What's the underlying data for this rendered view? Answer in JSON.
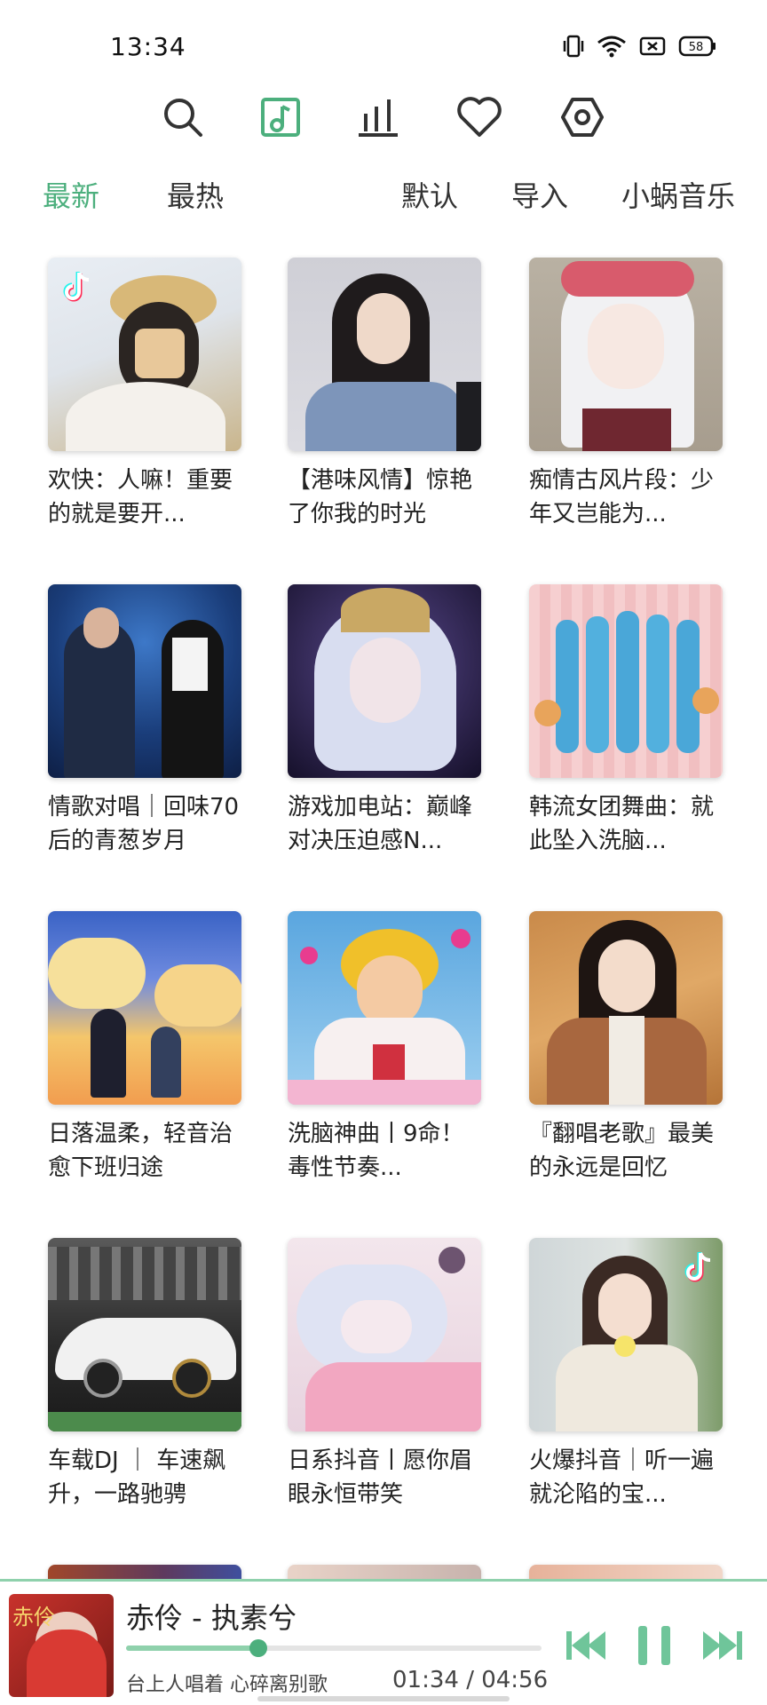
{
  "status": {
    "time": "13:34",
    "battery": "58",
    "icons": [
      "vibrate-icon",
      "wifi-icon",
      "sim-off-icon",
      "battery-icon"
    ]
  },
  "nav": {
    "icons": [
      "search-icon",
      "music-library-icon",
      "chart-icon",
      "favorite-icon",
      "settings-icon"
    ],
    "active_color": "#4caf7d"
  },
  "tabs": [
    "最新",
    "最热",
    "默认",
    "导入",
    "小蜗音乐"
  ],
  "active_tab": "最新",
  "playlists": [
    {
      "title": "欢快：人嘛！重要的就是要开...",
      "cover": "girl-with-hat"
    },
    {
      "title": "【港味风情】惊艳了你我的时光",
      "cover": "girl-portrait"
    },
    {
      "title": "痴情古风片段：少年又岂能为...",
      "cover": "anime-ancient-girl"
    },
    {
      "title": "情歌对唱｜回味70后的青葱岁月",
      "cover": "duet-stage"
    },
    {
      "title": "游戏加电站：巅峰对决压迫感N...",
      "cover": "game-character"
    },
    {
      "title": "韩流女团舞曲：就此坠入洗脑...",
      "cover": "girl-group"
    },
    {
      "title": "日落温柔，轻音治愈下班归途",
      "cover": "sunset-anime"
    },
    {
      "title": "洗脑神曲丨9命！毒性节奏...",
      "cover": "cartoon-hero"
    },
    {
      "title": "『翻唱老歌』最美的永远是回忆",
      "cover": "autumn-woman"
    },
    {
      "title": "车载DJ ｜ 车速飙升，一路驰骋",
      "cover": "sports-car"
    },
    {
      "title": "日系抖音丨愿你眉眼永恒带笑",
      "cover": "sleeping-anime"
    },
    {
      "title": "火爆抖音｜听一遍就沦陷的宝...",
      "cover": "girl-flower"
    }
  ],
  "player": {
    "title": "赤伶 - 执素兮",
    "lyric": "台上人唱着 心碎离别歌",
    "time": "01:34 / 04:56",
    "progress": 0.319,
    "cover_text": "赤伶",
    "controls": [
      "previous-icon",
      "pause-icon",
      "next-icon"
    ]
  }
}
